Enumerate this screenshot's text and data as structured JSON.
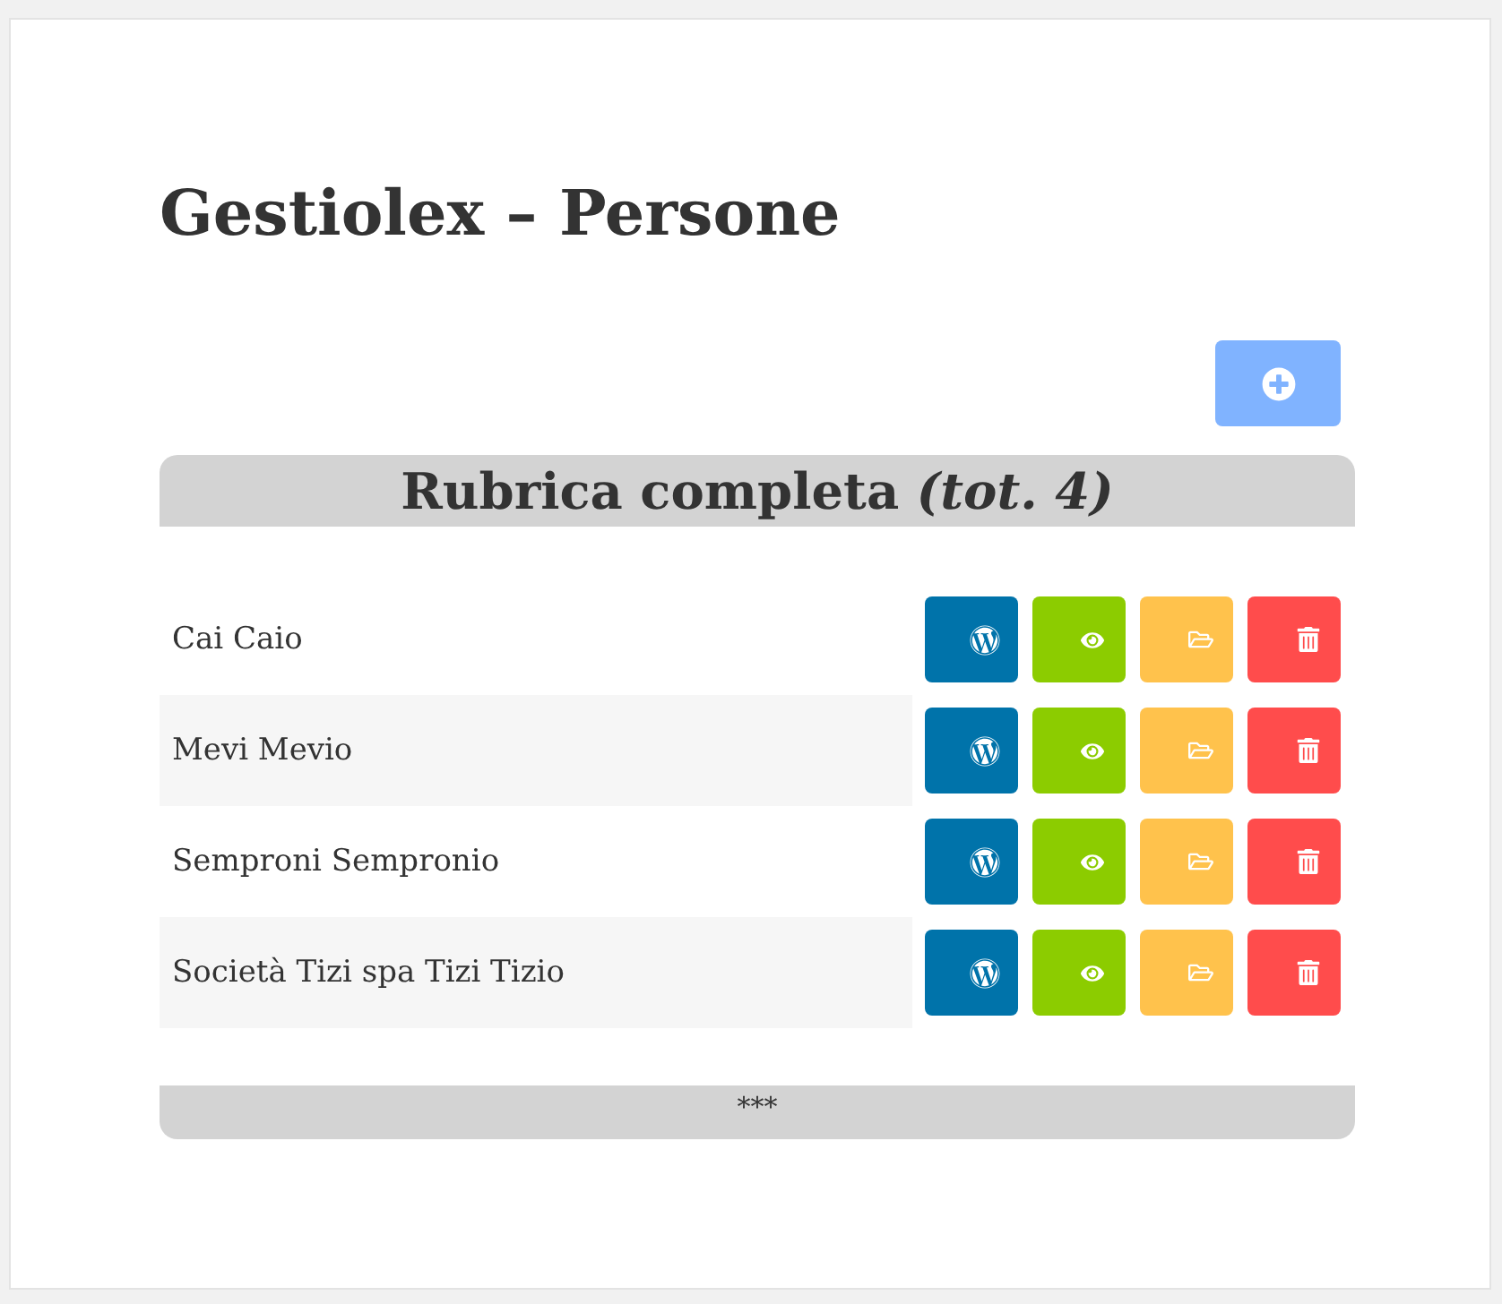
{
  "page": {
    "title": "Gestiolex – Persone"
  },
  "directory": {
    "heading": "Rubrica completa *(tot. 4)*",
    "rows": [
      {
        "name": "Cai Caio"
      },
      {
        "name": "Mevi Mevio"
      },
      {
        "name": "Semproni Sempronio"
      },
      {
        "name": "Società Tizi spa Tizi Tizio"
      }
    ],
    "footer": "***"
  }
}
